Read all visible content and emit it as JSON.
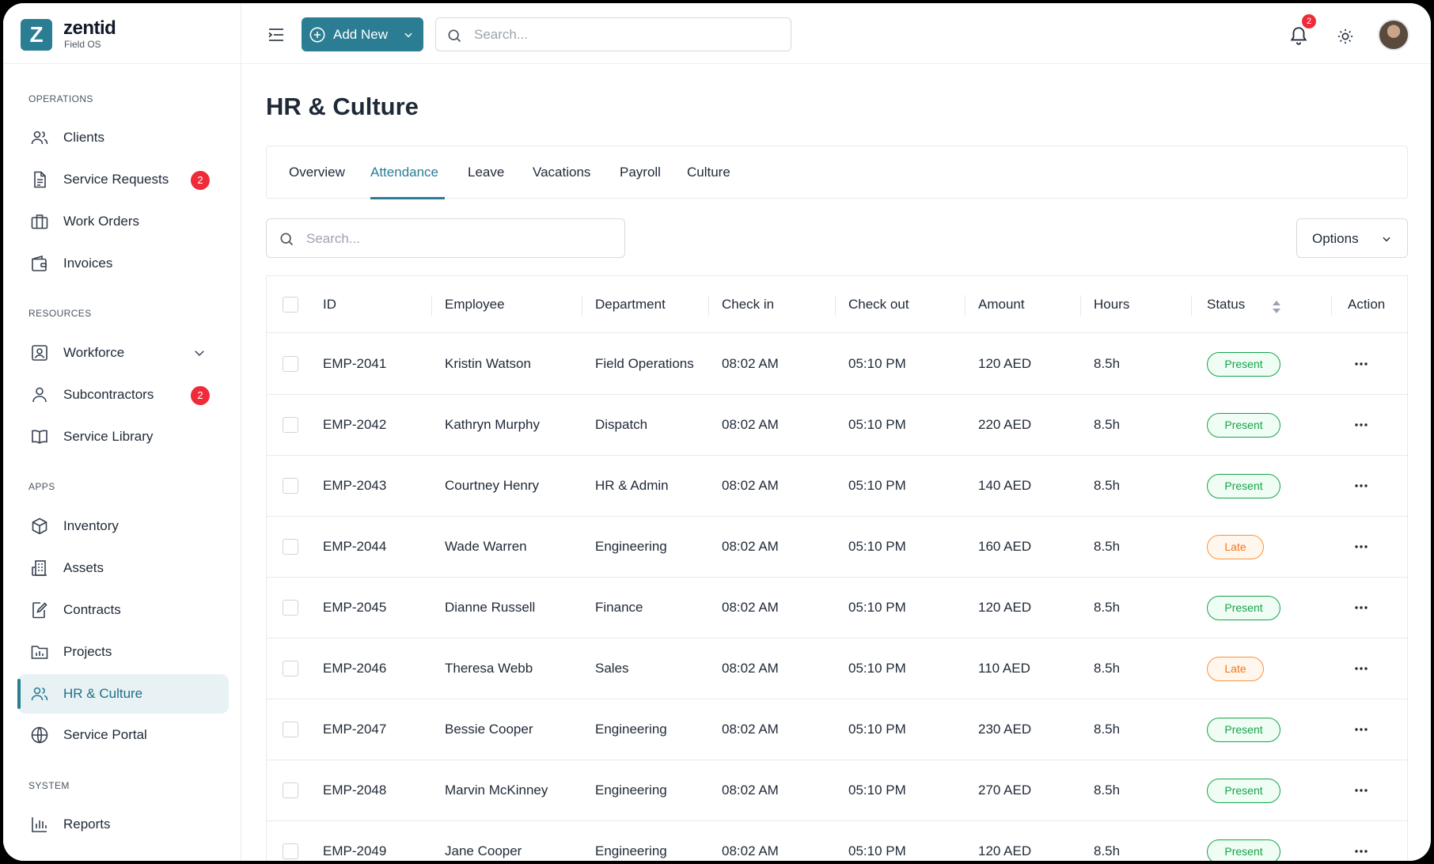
{
  "brand": {
    "name": "zentid",
    "sub": "Field OS",
    "logo_letter": "Z"
  },
  "sidebar": {
    "sections": {
      "operations": "OPERATIONS",
      "resources": "RESOURCES",
      "apps": "APPS",
      "system": "SYSTEM"
    },
    "items": [
      {
        "label": "Clients",
        "icon": "users-icon"
      },
      {
        "label": "Service Requests",
        "icon": "document-icon",
        "badge": "2"
      },
      {
        "label": "Work Orders",
        "icon": "briefcase-icon"
      },
      {
        "label": "Invoices",
        "icon": "wallet-icon"
      },
      {
        "label": "Workforce",
        "icon": "id-badge-icon"
      },
      {
        "label": "Subcontractors",
        "icon": "user-icon",
        "badge": "2"
      },
      {
        "label": "Service Library",
        "icon": "book-icon"
      },
      {
        "label": "Inventory",
        "icon": "box-icon"
      },
      {
        "label": "Assets",
        "icon": "building-icon"
      },
      {
        "label": "Contracts",
        "icon": "contract-icon"
      },
      {
        "label": "Projects",
        "icon": "folder-chart-icon"
      },
      {
        "label": "HR & Culture",
        "icon": "users-icon",
        "active": true
      },
      {
        "label": "Service Portal",
        "icon": "globe-icon"
      },
      {
        "label": "Reports",
        "icon": "bar-chart-icon"
      }
    ]
  },
  "topbar": {
    "add_new_label": "Add New",
    "search_placeholder": "Search...",
    "notification_count": "2"
  },
  "page": {
    "title": "HR & Culture",
    "tabs": [
      "Overview",
      "Attendance",
      "Leave",
      "Vacations",
      "Payroll",
      "Culture"
    ],
    "active_tab": "Attendance",
    "table_search_placeholder": "Search...",
    "options_label": "Options"
  },
  "table": {
    "columns": [
      "ID",
      "Employee",
      "Department",
      "Check in",
      "Check out",
      "Amount",
      "Hours",
      "Status",
      "Action"
    ],
    "rows": [
      {
        "id": "EMP-2041",
        "employee": "Kristin Watson",
        "department": "Field Operations",
        "check_in": "08:02 AM",
        "check_out": "05:10 PM",
        "amount": "120 AED",
        "hours": "8.5h",
        "status": "Present"
      },
      {
        "id": "EMP-2042",
        "employee": "Kathryn Murphy",
        "department": "Dispatch",
        "check_in": "08:02 AM",
        "check_out": "05:10 PM",
        "amount": "220 AED",
        "hours": "8.5h",
        "status": "Present"
      },
      {
        "id": "EMP-2043",
        "employee": "Courtney Henry",
        "department": "HR & Admin",
        "check_in": "08:02 AM",
        "check_out": "05:10 PM",
        "amount": "140 AED",
        "hours": "8.5h",
        "status": "Present"
      },
      {
        "id": "EMP-2044",
        "employee": "Wade Warren",
        "department": "Engineering",
        "check_in": "08:02 AM",
        "check_out": "05:10 PM",
        "amount": "160 AED",
        "hours": "8.5h",
        "status": "Late"
      },
      {
        "id": "EMP-2045",
        "employee": "Dianne Russell",
        "department": "Finance",
        "check_in": "08:02 AM",
        "check_out": "05:10 PM",
        "amount": "120 AED",
        "hours": "8.5h",
        "status": "Present"
      },
      {
        "id": "EMP-2046",
        "employee": "Theresa Webb",
        "department": "Sales",
        "check_in": "08:02 AM",
        "check_out": "05:10 PM",
        "amount": "110 AED",
        "hours": "8.5h",
        "status": "Late"
      },
      {
        "id": "EMP-2047",
        "employee": "Bessie Cooper",
        "department": "Engineering",
        "check_in": "08:02 AM",
        "check_out": "05:10 PM",
        "amount": "230 AED",
        "hours": "8.5h",
        "status": "Present"
      },
      {
        "id": "EMP-2048",
        "employee": "Marvin McKinney",
        "department": "Engineering",
        "check_in": "08:02 AM",
        "check_out": "05:10 PM",
        "amount": "270 AED",
        "hours": "8.5h",
        "status": "Present"
      },
      {
        "id": "EMP-2049",
        "employee": "Jane Cooper",
        "department": "Engineering",
        "check_in": "08:02 AM",
        "check_out": "05:10 PM",
        "amount": "120 AED",
        "hours": "8.5h",
        "status": "Present"
      }
    ]
  },
  "colors": {
    "brand": "#2a7d92",
    "badge": "#ef2b3a",
    "present": "#16a34a",
    "late": "#f97316"
  }
}
